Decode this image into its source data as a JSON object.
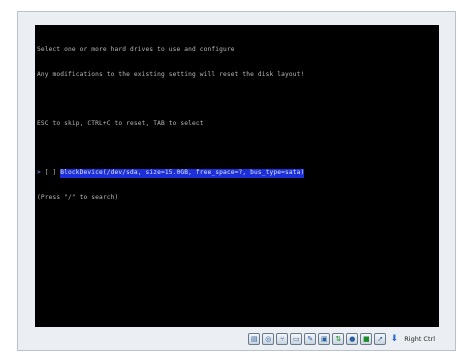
{
  "console": {
    "line1": "Select one or more hard drives to use and configure",
    "line2": "Any modifications to the existing setting will reset the disk layout!",
    "line3": "ESC to skip, CTRL+C to reset, TAB to select",
    "selected_arrow": ">",
    "checkbox": " [ ] ",
    "device": "BlockDevice(/dev/sda, size=15.0GB, free_space=?, bus_type=sata)",
    "search_hint": "(Press \"/\" to search)"
  },
  "statusbar": {
    "icons": [
      "hard-disk-icon",
      "optical-drive-icon",
      "usb-icon",
      "shared-folder-icon",
      "pencil-icon",
      "display-icon",
      "network-icon",
      "recording-icon",
      "cpu-icon",
      "mouse-integration-icon",
      "host-key-arrow-icon"
    ],
    "host_key_label": "Right Ctrl"
  },
  "colors": {
    "screen_background": "#000000",
    "console_text": "#b8b8b8",
    "highlight_background": "#1c2fd8",
    "arrow": "#6fa3ff",
    "frame": "#ebeef2"
  }
}
